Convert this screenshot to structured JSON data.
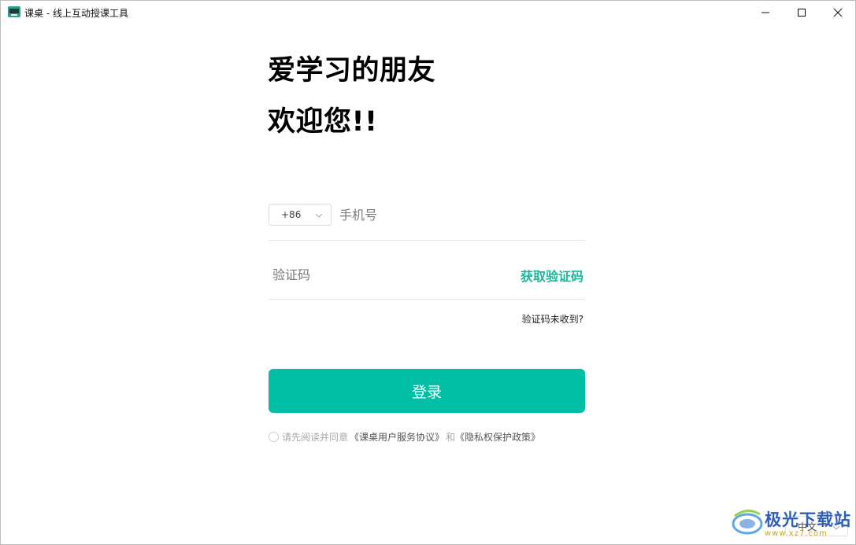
{
  "window": {
    "title": "课桌 - 线上互动授课工具",
    "controls": {
      "minimize": "minimize-icon",
      "maximize": "maximize-icon",
      "close": "close-icon"
    }
  },
  "welcome": {
    "line1": "爱学习的朋友",
    "line2": "欢迎您!!"
  },
  "login_form": {
    "country_code": "+86",
    "phone_placeholder": "手机号",
    "code_placeholder": "验证码",
    "get_code_label": "获取验证码",
    "not_received_label": "验证码未收到?",
    "login_button": "登录",
    "agreement_prefix": "请先阅读并同意",
    "user_agreement": "《课桌用户服务协议》",
    "agreement_and": "和",
    "privacy_policy": "《隐私权保护政策》"
  },
  "language": {
    "selected": "中文"
  },
  "watermark": {
    "name": "极光下载站",
    "url": "www.xz7.com"
  },
  "colors": {
    "accent": "#00bfa5",
    "link_accent": "#15b99b"
  }
}
